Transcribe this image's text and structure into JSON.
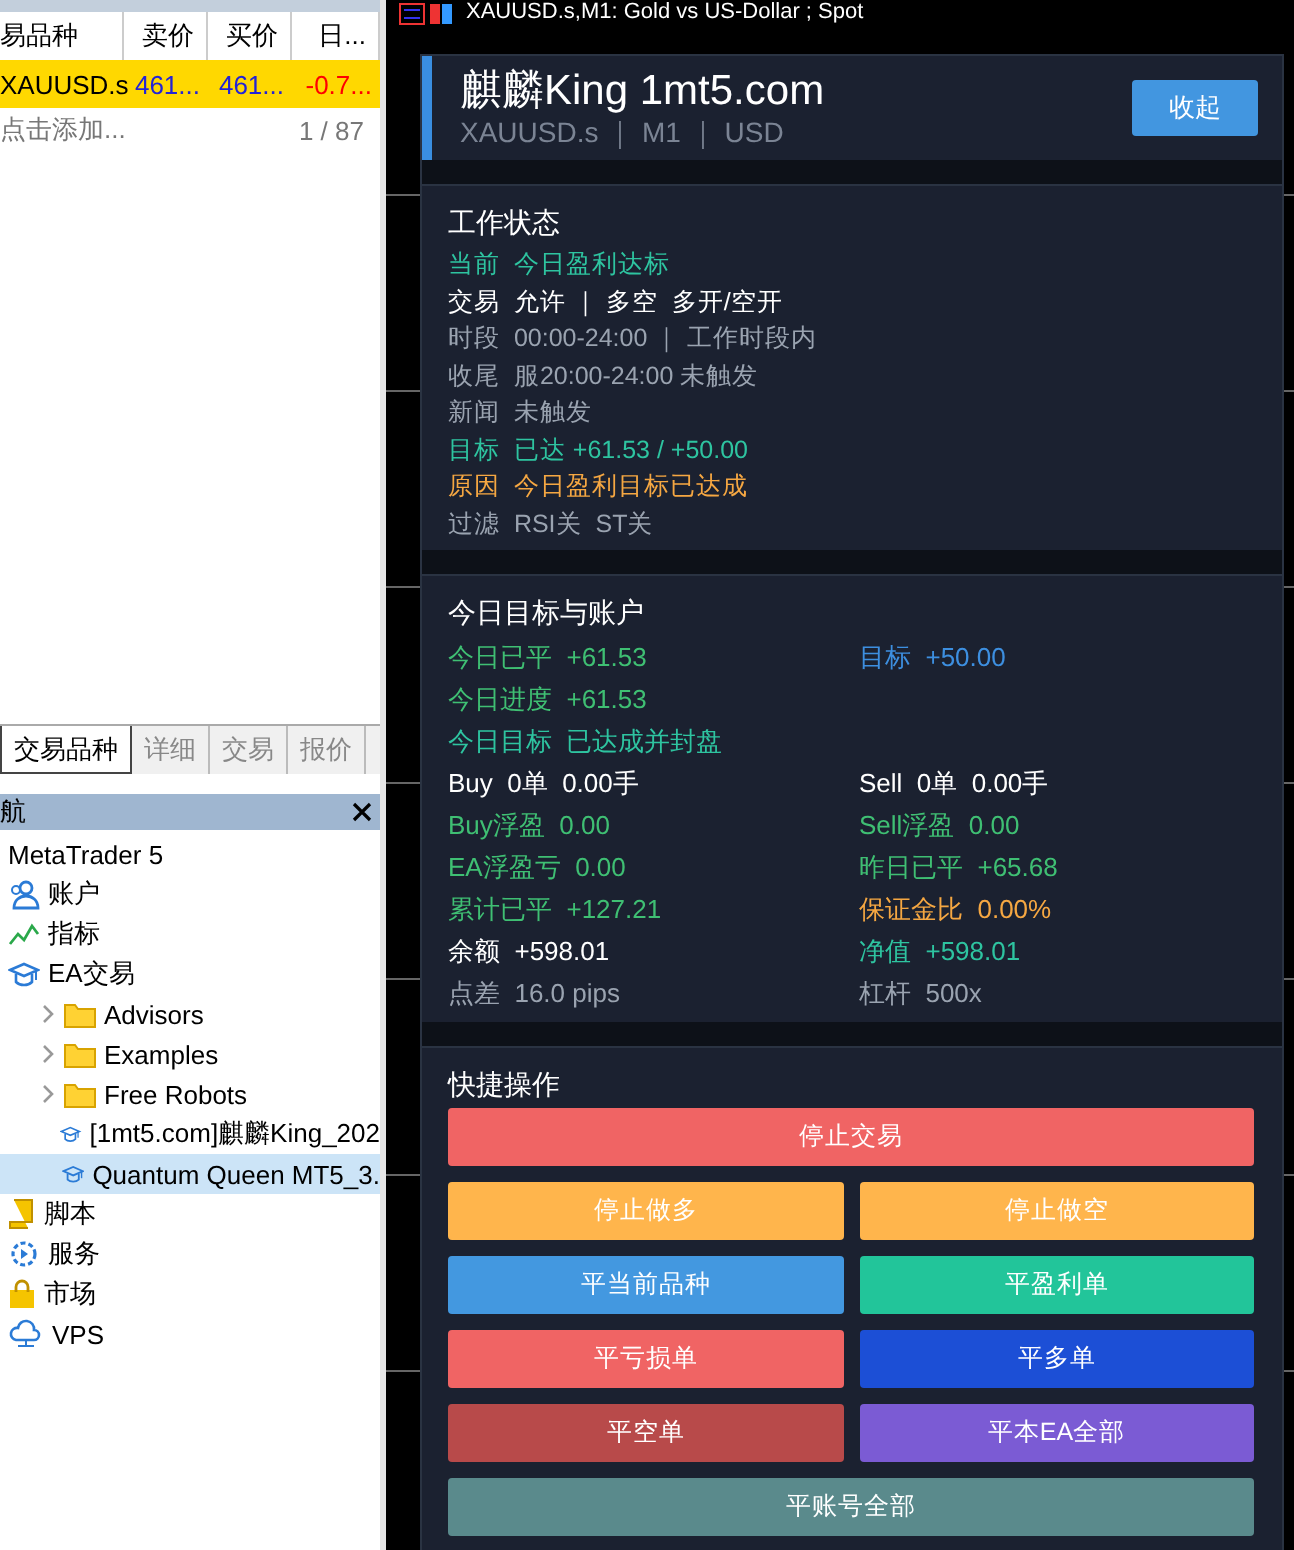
{
  "market_watch": {
    "columns": [
      "易品种",
      "卖价",
      "买价",
      "日..."
    ],
    "rows": [
      {
        "symbol": "XAUUSD.s",
        "bid": "461...",
        "ask": "461...",
        "change": "-0.7...",
        "selected": true
      }
    ],
    "add_hint": "点击添加...",
    "count": "1 / 87"
  },
  "tabs": [
    {
      "label": "交易品种",
      "selected": true
    },
    {
      "label": "详细",
      "selected": false
    },
    {
      "label": "交易",
      "selected": false
    },
    {
      "label": "报价",
      "selected": false
    }
  ],
  "navigator": {
    "title": "航",
    "tree": [
      {
        "label": "MetaTrader 5",
        "children": [
          {
            "label": "账户",
            "kind": "account"
          },
          {
            "label": "指标",
            "kind": "indicator"
          },
          {
            "label": "EA交易",
            "kind": "ea",
            "children": [
              {
                "label": "Advisors",
                "kind": "folder",
                "expanded": false
              },
              {
                "label": "Examples",
                "kind": "folder",
                "expanded": false
              },
              {
                "label": "Free Robots",
                "kind": "folder",
                "expanded": false
              },
              {
                "label": "[1mt5.com]麒麟King_202",
                "kind": "ea",
                "selected": false
              },
              {
                "label": "Quantum Queen MT5_3.",
                "kind": "ea",
                "selected": true
              }
            ]
          },
          {
            "label": "脚本",
            "kind": "script"
          },
          {
            "label": "服务",
            "kind": "service"
          },
          {
            "label": "市场",
            "kind": "market"
          },
          {
            "label": "VPS",
            "kind": "vps"
          }
        ]
      }
    ]
  },
  "chart_title": "XAUUSD.s,M1: Gold vs US-Dollar ; Spot",
  "panel": {
    "title": "麒麟King 1mt5.com",
    "subtitle": "XAUUSD.s ｜ M1 ｜ USD",
    "collapse_button": "收起",
    "status": {
      "title": "工作状态",
      "lines": [
        {
          "label": "当前",
          "value": "今日盈利达标",
          "color": "#2ec4a0"
        },
        {
          "label": "交易",
          "value": "允许 ｜ 多空  多开/空开",
          "color": "#ffffff"
        },
        {
          "label": "时段",
          "value": "00:00-24:00 ｜ 工作时段内",
          "color": "#9aa3b0"
        },
        {
          "label": "收尾",
          "value": "服20:00-24:00 未触发",
          "color": "#9aa3b0"
        },
        {
          "label": "新闻",
          "value": "未触发",
          "color": "#9aa3b0"
        },
        {
          "label": "目标",
          "value": "已达 +61.53 / +50.00",
          "color": "#2ec4a0"
        },
        {
          "label": "原因",
          "value": "今日盈利目标已达成",
          "color": "#f5a742"
        },
        {
          "label": "过滤",
          "value": "RSI关  ST关",
          "color": "#9aa3b0"
        }
      ]
    },
    "account": {
      "title": "今日目标与账户",
      "rows": [
        {
          "left": {
            "label": "今日已平",
            "value": "+61.53",
            "color": "#3fbf73"
          },
          "right": {
            "label": "目标",
            "value": "+50.00",
            "color": "#3d8fe0"
          }
        },
        {
          "left": {
            "label": "今日进度",
            "value": "+61.53",
            "color": "#3fbf73"
          }
        },
        {
          "left": {
            "label": "今日目标",
            "value": "已达成并封盘",
            "color": "#2ec4a0"
          }
        },
        {
          "left": {
            "label": "Buy",
            "value": "0单  0.00手",
            "color": "#ffffff"
          },
          "right": {
            "label": "Sell",
            "value": "0单  0.00手",
            "color": "#ffffff"
          }
        },
        {
          "left": {
            "label": "Buy浮盈",
            "value": "0.00",
            "color": "#3fbf73"
          },
          "right": {
            "label": "Sell浮盈",
            "value": "0.00",
            "color": "#3fbf73"
          }
        },
        {
          "left": {
            "label": "EA浮盈亏",
            "value": "0.00",
            "color": "#3fbf73"
          },
          "right": {
            "label": "昨日已平",
            "value": "+65.68",
            "color": "#3fbf73"
          }
        },
        {
          "left": {
            "label": "累计已平",
            "value": "+127.21",
            "color": "#3fbf73"
          },
          "right": {
            "label": "保证金比",
            "value": "0.00%",
            "color": "#f5a742"
          }
        },
        {
          "left": {
            "label": "余额",
            "value": "+598.01",
            "color": "#ffffff"
          },
          "right": {
            "label": "净值",
            "value": "+598.01",
            "color": "#2ec4a0"
          }
        },
        {
          "left": {
            "label": "点差",
            "value": "16.0 pips",
            "color": "#9aa3b0"
          },
          "right": {
            "label": "杠杆",
            "value": "500x",
            "color": "#9aa3b0"
          }
        }
      ]
    },
    "actions": {
      "title": "快捷操作",
      "buttons": [
        {
          "label": "停止交易",
          "color": "#f06464",
          "wide": true
        },
        {
          "label": "停止做多",
          "color": "#ffb54c",
          "wide": false
        },
        {
          "label": "停止做空",
          "color": "#ffb54c",
          "wide": false
        },
        {
          "label": "平当前品种",
          "color": "#4398e0",
          "wide": false
        },
        {
          "label": "平盈利单",
          "color": "#22c59a",
          "wide": false
        },
        {
          "label": "平亏损单",
          "color": "#f06464",
          "wide": false
        },
        {
          "label": "平多单",
          "color": "#1c4fd6",
          "wide": false
        },
        {
          "label": "平空单",
          "color": "#b84a4a",
          "wide": false
        },
        {
          "label": "平本EA全部",
          "color": "#7b5bd4",
          "wide": false
        },
        {
          "label": "平账号全部",
          "color": "#5a8a8c",
          "wide": true
        }
      ]
    }
  }
}
